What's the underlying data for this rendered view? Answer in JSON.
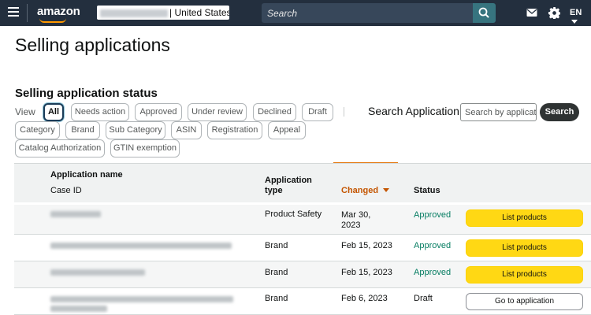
{
  "nav": {
    "logo": "amazon",
    "store_suffix": "| United States",
    "search_placeholder": "Search",
    "language": "EN"
  },
  "page": {
    "title": "Selling applications",
    "section_title": "Selling application status",
    "view_label": "View"
  },
  "filters": [
    {
      "label": "All",
      "active": true
    },
    {
      "label": "Needs action"
    },
    {
      "label": "Approved"
    },
    {
      "label": "Under review"
    },
    {
      "label": "Declined"
    },
    {
      "label": "Draft"
    },
    {
      "label": "Category"
    },
    {
      "label": "Brand"
    },
    {
      "label": "Sub Category"
    },
    {
      "label": "ASIN"
    },
    {
      "label": "Registration"
    },
    {
      "label": "Appeal"
    },
    {
      "label": "Catalog Authorization"
    },
    {
      "label": "GTIN exemption"
    }
  ],
  "search_application": {
    "label": "Search Application",
    "placeholder": "Search by applicat",
    "button": "Search"
  },
  "table": {
    "headers": {
      "name": "Application name",
      "case_id": "Case ID",
      "type_line1": "Application",
      "type_line2": "type",
      "changed": "Changed",
      "status": "Status"
    },
    "rows": [
      {
        "type": "Product Safety",
        "changed_line1": "Mar 30,",
        "changed_line2": "2023",
        "status": "Approved",
        "action": "List products"
      },
      {
        "type": "Brand",
        "changed_line1": "Feb 15, 2023",
        "changed_line2": "",
        "status": "Approved",
        "action": "List products"
      },
      {
        "type": "Brand",
        "changed_line1": "Feb 15, 2023",
        "changed_line2": "",
        "status": "Approved",
        "action": "List products"
      },
      {
        "type": "Brand",
        "changed_line1": "Feb 6, 2023",
        "changed_line2": "",
        "status": "Draft",
        "action": "Go to application"
      }
    ]
  },
  "colors": {
    "nav_bg": "#232f3e",
    "search_bg": "#37475a",
    "search_btn": "#37747f",
    "approved": "#067d62",
    "sort_accent": "#c45500",
    "primary_button": "#ffd814"
  },
  "icons": [
    "hamburger-icon",
    "search-icon",
    "mail-icon",
    "gear-icon",
    "caret-down-icon"
  ]
}
